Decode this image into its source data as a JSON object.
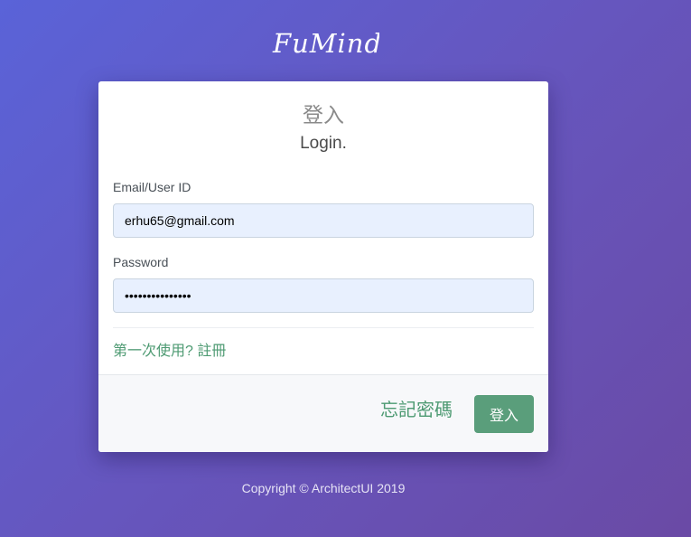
{
  "brand": {
    "logo_text": "FuMind"
  },
  "login_card": {
    "title_cn": "登入",
    "title_en": "Login.",
    "email": {
      "label": "Email/User ID",
      "value": "erhu65@gmail.com"
    },
    "password": {
      "label": "Password",
      "value": "•••••••••••••••"
    },
    "register_link": "第一次使用? 註冊",
    "forgot_password": "忘記密碼",
    "login_button": "登入"
  },
  "footer": {
    "copyright": "Copyright © ArchitectUI 2019"
  },
  "colors": {
    "accent_green": "#5a9e7b",
    "link_green": "#4d9a72",
    "input_bg": "#e8f0fe",
    "bg_gradient_start": "#5a63d8",
    "bg_gradient_end": "#6a4aa5"
  }
}
